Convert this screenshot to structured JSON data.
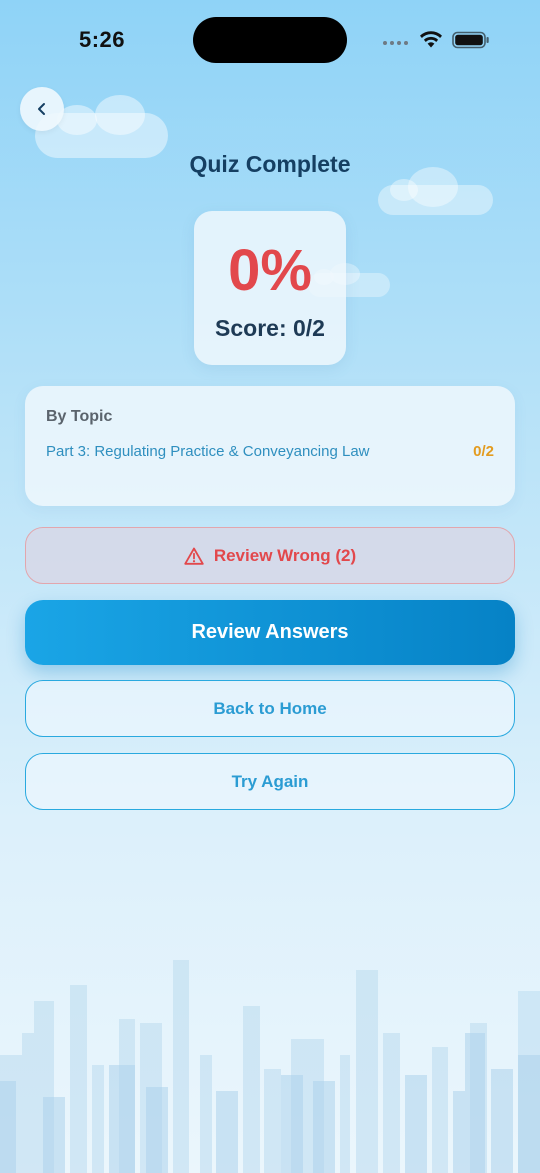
{
  "status_bar": {
    "time": "5:26"
  },
  "header": {
    "title": "Quiz Complete"
  },
  "score": {
    "percent": "0%",
    "label": "Score: 0/2"
  },
  "topics": {
    "heading": "By Topic",
    "items": [
      {
        "name": "Part 3: Regulating Practice & Conveyancing Law",
        "score": "0/2"
      }
    ]
  },
  "actions": {
    "review_wrong": "Review Wrong (2)",
    "review_answers": "Review Answers",
    "back_home": "Back to Home",
    "try_again": "Try Again"
  },
  "icons": {
    "back": "chevron-left-icon",
    "warning": "warning-triangle-icon",
    "wifi": "wifi-icon",
    "battery": "battery-icon"
  },
  "colors": {
    "accent": "#1aa5e6",
    "score_red": "#e2484c",
    "topic_score": "#e39b1f",
    "title": "#153f62"
  }
}
